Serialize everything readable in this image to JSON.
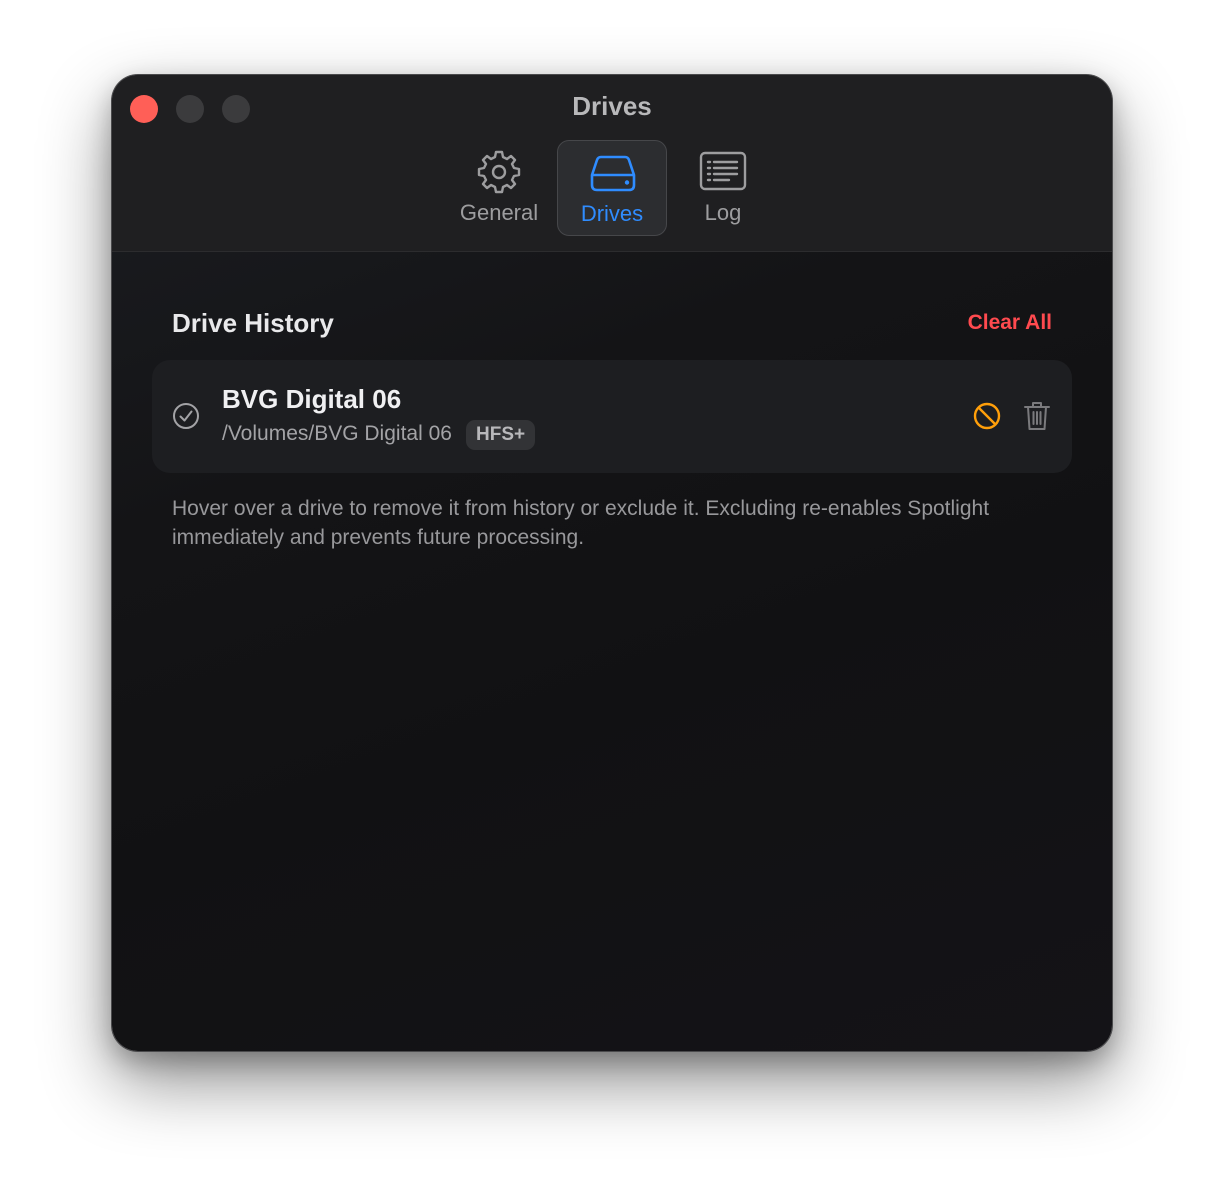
{
  "window": {
    "title": "Drives"
  },
  "tabs": [
    {
      "label": "General",
      "icon": "gear-icon",
      "selected": false
    },
    {
      "label": "Drives",
      "icon": "drive-icon",
      "selected": true
    },
    {
      "label": "Log",
      "icon": "log-icon",
      "selected": false
    }
  ],
  "drive_history": {
    "title": "Drive History",
    "clear_all_label": "Clear All",
    "drives": [
      {
        "name": "BVG Digital 06",
        "path": "/Volumes/BVG Digital 06",
        "filesystem": "HFS+",
        "status_icon": "checkmark-circle-icon",
        "actions": [
          "exclude-icon",
          "trash-icon"
        ]
      }
    ],
    "help_text": "Hover over a drive to remove it from history or exclude it. Excluding re-enables Spotlight immediately and prevents future processing."
  },
  "colors": {
    "accent": "#2f8cff",
    "destructive": "#ff4a4f",
    "exclude": "#ff9f0a",
    "close_button": "#ff5f57"
  }
}
